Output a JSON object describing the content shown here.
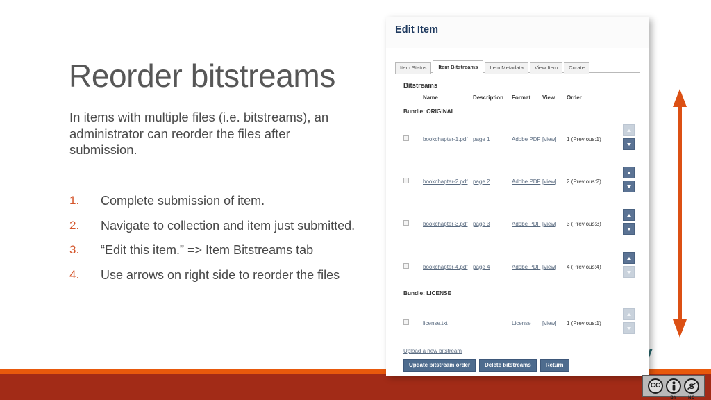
{
  "slide": {
    "title": "Reorder bitstreams",
    "lead": "In items with multiple files (i.e. bitstreams), an administrator can reorder the files after submission.",
    "steps": [
      {
        "num": "1.",
        "text": "Complete submission of item."
      },
      {
        "num": "2.",
        "text": "Navigate to collection and item just submitted."
      },
      {
        "num": "3.",
        "text": "“Edit this item.” => Item Bitstreams tab"
      },
      {
        "num": "4.",
        "text": "Use arrows on right side to reorder the files"
      }
    ],
    "partial_glyph": "y",
    "colors": {
      "accent_orange": "#E8590C",
      "band_red": "#A22B17",
      "list_number": "#D4552B",
      "title_gray": "#575757",
      "teal_glyph": "#2A6B72"
    }
  },
  "annotation": {
    "double_arrow_icon": "vertical-double-arrow-icon",
    "color": "#DC5014",
    "direction": "up-down"
  },
  "screenshot": {
    "header_title": "Edit Item",
    "tabs": [
      {
        "label": "Item Status",
        "active": false
      },
      {
        "label": "Item Bitstreams",
        "active": true
      },
      {
        "label": "Item Metadata",
        "active": false
      },
      {
        "label": "View Item",
        "active": false
      },
      {
        "label": "Curate",
        "active": false
      }
    ],
    "section_title": "Bitstreams",
    "columns": [
      "",
      "Name",
      "Description",
      "Format",
      "View",
      "Order"
    ],
    "bundles": [
      {
        "label": "Bundle: ORIGINAL",
        "rows": [
          {
            "name": "bookchapter-1.pdf",
            "description": "page 1",
            "format": "Adobe PDF",
            "view": "[view]",
            "order": "1 (Previous:1)",
            "up_enabled": false,
            "down_enabled": true
          },
          {
            "name": "bookchapter-2.pdf",
            "description": "page 2",
            "format": "Adobe PDF",
            "view": "[view]",
            "order": "2 (Previous:2)",
            "up_enabled": true,
            "down_enabled": true
          },
          {
            "name": "bookchapter-3.pdf",
            "description": "page 3",
            "format": "Adobe PDF",
            "view": "[view]",
            "order": "3 (Previous:3)",
            "up_enabled": true,
            "down_enabled": true
          },
          {
            "name": "bookchapter-4.pdf",
            "description": "page 4",
            "format": "Adobe PDF",
            "view": "[view]",
            "order": "4 (Previous:4)",
            "up_enabled": true,
            "down_enabled": false
          }
        ]
      },
      {
        "label": "Bundle: LICENSE",
        "rows": [
          {
            "name": "license.txt",
            "description": "",
            "format": "License",
            "view": "[view]",
            "order": "1 (Previous:1)",
            "up_enabled": false,
            "down_enabled": false
          }
        ]
      }
    ],
    "upload_link": "Upload a new bitstream",
    "actions": [
      {
        "label": "Update bitstream order"
      },
      {
        "label": "Delete bitstreams"
      },
      {
        "label": "Return"
      }
    ]
  },
  "license_badge": {
    "cc": "CC",
    "by_label": "BY",
    "nc_label": "NC",
    "by_glyph": "i",
    "nc_glyph": "$"
  }
}
